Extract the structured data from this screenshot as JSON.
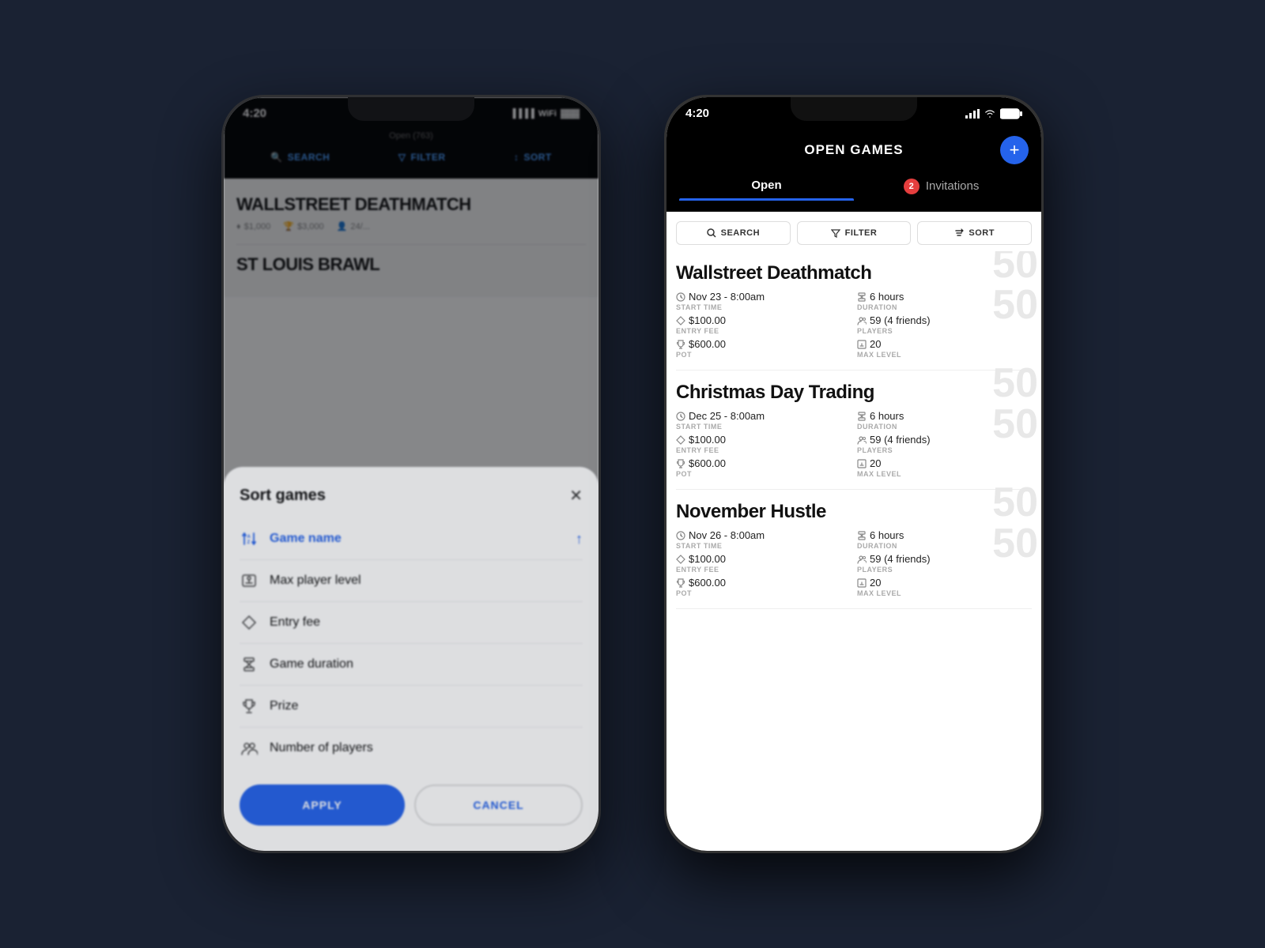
{
  "scene": {
    "background": "#1a2233"
  },
  "left_phone": {
    "status_bar": {
      "time": "4:20"
    },
    "header": {
      "nav_items": [
        "SEARCH",
        "FILTER",
        "SORT"
      ]
    },
    "games": [
      {
        "title": "WALLSTREET DEATHMATCH"
      },
      {
        "title": "ST LOUIS BRAWL"
      }
    ],
    "sort_modal": {
      "title": "Sort games",
      "close_label": "✕",
      "options": [
        {
          "label": "Game name",
          "active": true,
          "has_arrow": true
        },
        {
          "label": "Max player level",
          "active": false
        },
        {
          "label": "Entry fee",
          "active": false
        },
        {
          "label": "Game duration",
          "active": false
        },
        {
          "label": "Prize",
          "active": false
        },
        {
          "label": "Number of players",
          "active": false
        }
      ],
      "apply_label": "APPLY",
      "cancel_label": "CANCEL"
    }
  },
  "right_phone": {
    "status_bar": {
      "time": "4:20"
    },
    "header": {
      "title": "OPEN GAMES",
      "add_icon": "+"
    },
    "tabs": [
      {
        "label": "Open",
        "active": true
      },
      {
        "label": "Invitations",
        "active": false,
        "badge": "2"
      }
    ],
    "toolbar": [
      {
        "label": "SEARCH",
        "icon": "🔍"
      },
      {
        "label": "FILTER",
        "icon": "▽"
      },
      {
        "label": "SORT",
        "icon": "↕"
      }
    ],
    "games": [
      {
        "name": "Wallstreet Deathmatch",
        "start_time_value": "Nov 23 - 8:00am",
        "start_time_label": "START TIME",
        "duration_value": "6 hours",
        "duration_label": "DURATION",
        "entry_fee_value": "$100.00",
        "entry_fee_label": "ENTRY FEE",
        "players_value": "59 (4 friends)",
        "players_label": "PLAYERS",
        "pot_value": "$600.00",
        "pot_label": "POT",
        "max_level_value": "20",
        "max_level_label": "MAX LEVEL",
        "bg_number": "50"
      },
      {
        "name": "Christmas Day Trading",
        "start_time_value": "Dec 25 - 8:00am",
        "start_time_label": "START TIME",
        "duration_value": "6 hours",
        "duration_label": "DURATION",
        "entry_fee_value": "$100.00",
        "entry_fee_label": "ENTRY FEE",
        "players_value": "59 (4 friends)",
        "players_label": "PLAYERS",
        "pot_value": "$600.00",
        "pot_label": "POT",
        "max_level_value": "20",
        "max_level_label": "MAX LEVEL",
        "bg_number": "50"
      },
      {
        "name": "November Hustle",
        "start_time_value": "Nov 26 - 8:00am",
        "start_time_label": "START TIME",
        "duration_value": "6 hours",
        "duration_label": "DURATION",
        "entry_fee_value": "$100.00",
        "entry_fee_label": "ENTRY FEE",
        "players_value": "59 (4 friends)",
        "players_label": "PLAYERS",
        "pot_value": "$600.00",
        "pot_label": "POT",
        "max_level_value": "20",
        "max_level_label": "MAX LEVEL",
        "bg_number": "50"
      }
    ]
  }
}
